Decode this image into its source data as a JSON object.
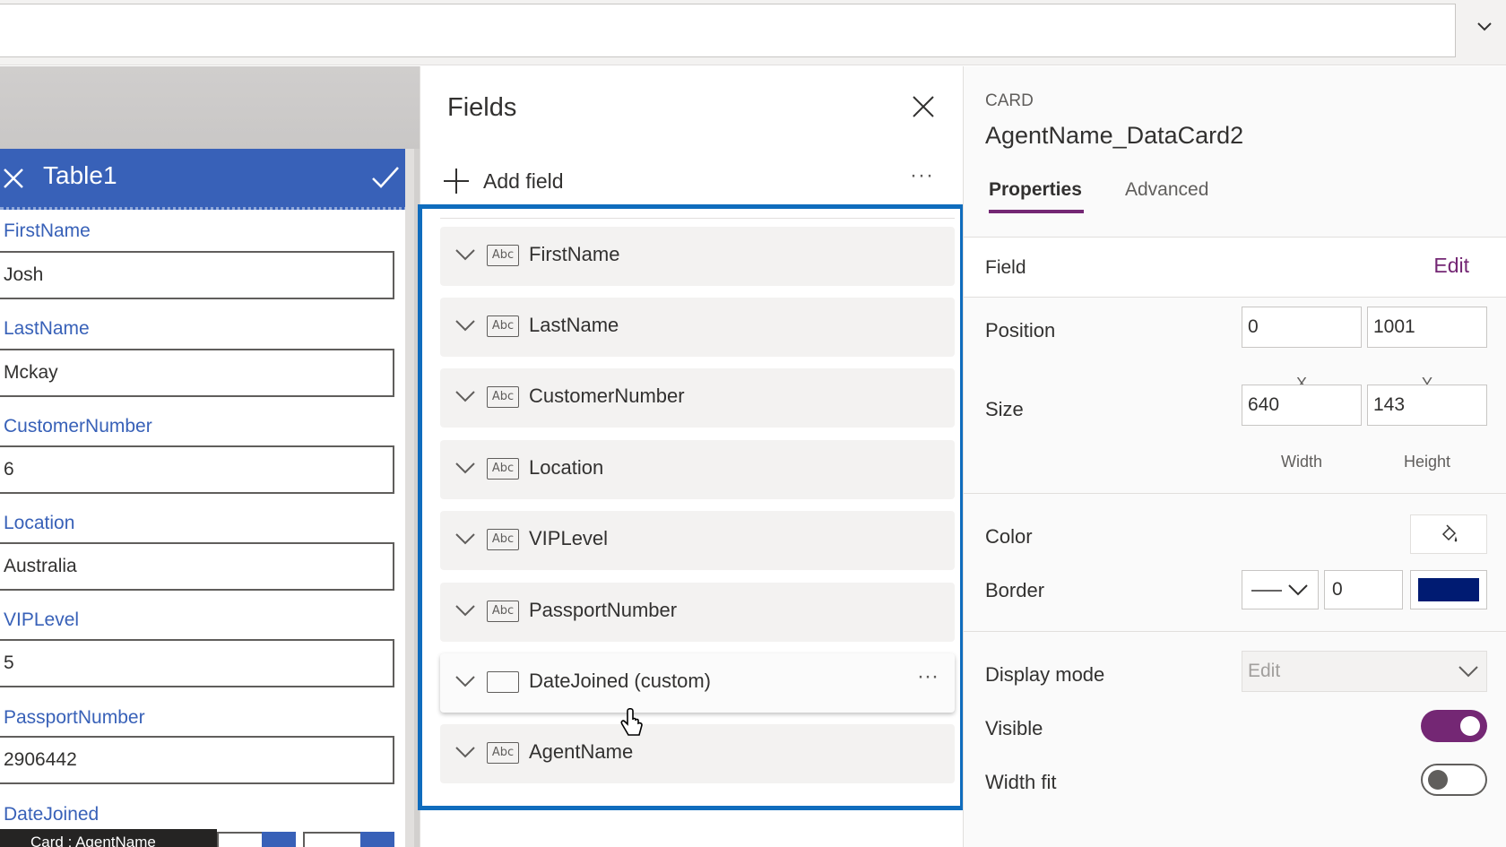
{
  "topbar": {
    "formula_value": ""
  },
  "form": {
    "title": "Table1",
    "fields": [
      {
        "label": "FirstName",
        "value": "Josh"
      },
      {
        "label": "LastName",
        "value": "Mckay"
      },
      {
        "label": "CustomerNumber",
        "value": "6"
      },
      {
        "label": "Location",
        "value": "Australia"
      },
      {
        "label": "VIPLevel",
        "value": "5"
      },
      {
        "label": "PassportNumber",
        "value": "2906442"
      },
      {
        "label": "DateJoined",
        "value": ""
      }
    ],
    "tooltip": "Card : AgentName"
  },
  "fields_panel": {
    "title": "Fields",
    "add_field_label": "Add field",
    "more_label": "···",
    "items": [
      {
        "label": "FirstName",
        "type_icon": "Abc"
      },
      {
        "label": "LastName",
        "type_icon": "Abc"
      },
      {
        "label": "CustomerNumber",
        "type_icon": "Abc"
      },
      {
        "label": "Location",
        "type_icon": "Abc"
      },
      {
        "label": "VIPLevel",
        "type_icon": "Abc"
      },
      {
        "label": "PassportNumber",
        "type_icon": "Abc"
      },
      {
        "label": "DateJoined (custom)",
        "type_icon": "custom-card-icon"
      },
      {
        "label": "AgentName",
        "type_icon": "Abc"
      }
    ],
    "accent_color": "#0F6CBD"
  },
  "properties": {
    "kind": "CARD",
    "name": "AgentName_DataCard2",
    "tabs": {
      "properties": "Properties",
      "advanced": "Advanced"
    },
    "field": {
      "label": "Field",
      "edit": "Edit"
    },
    "position": {
      "label": "Position",
      "x": "0",
      "y": "1001",
      "x_label": "X",
      "y_label": "Y"
    },
    "size": {
      "label": "Size",
      "width": "640",
      "height": "143",
      "width_label": "Width",
      "height_label": "Height"
    },
    "color": {
      "label": "Color"
    },
    "border": {
      "label": "Border",
      "width": "0",
      "color": "#001B72"
    },
    "display_mode": {
      "label": "Display mode",
      "value": "Edit"
    },
    "visible": {
      "label": "Visible",
      "state": "On"
    },
    "width_fit": {
      "label": "Width fit",
      "state": "Off"
    },
    "accent_color": "#742774"
  }
}
